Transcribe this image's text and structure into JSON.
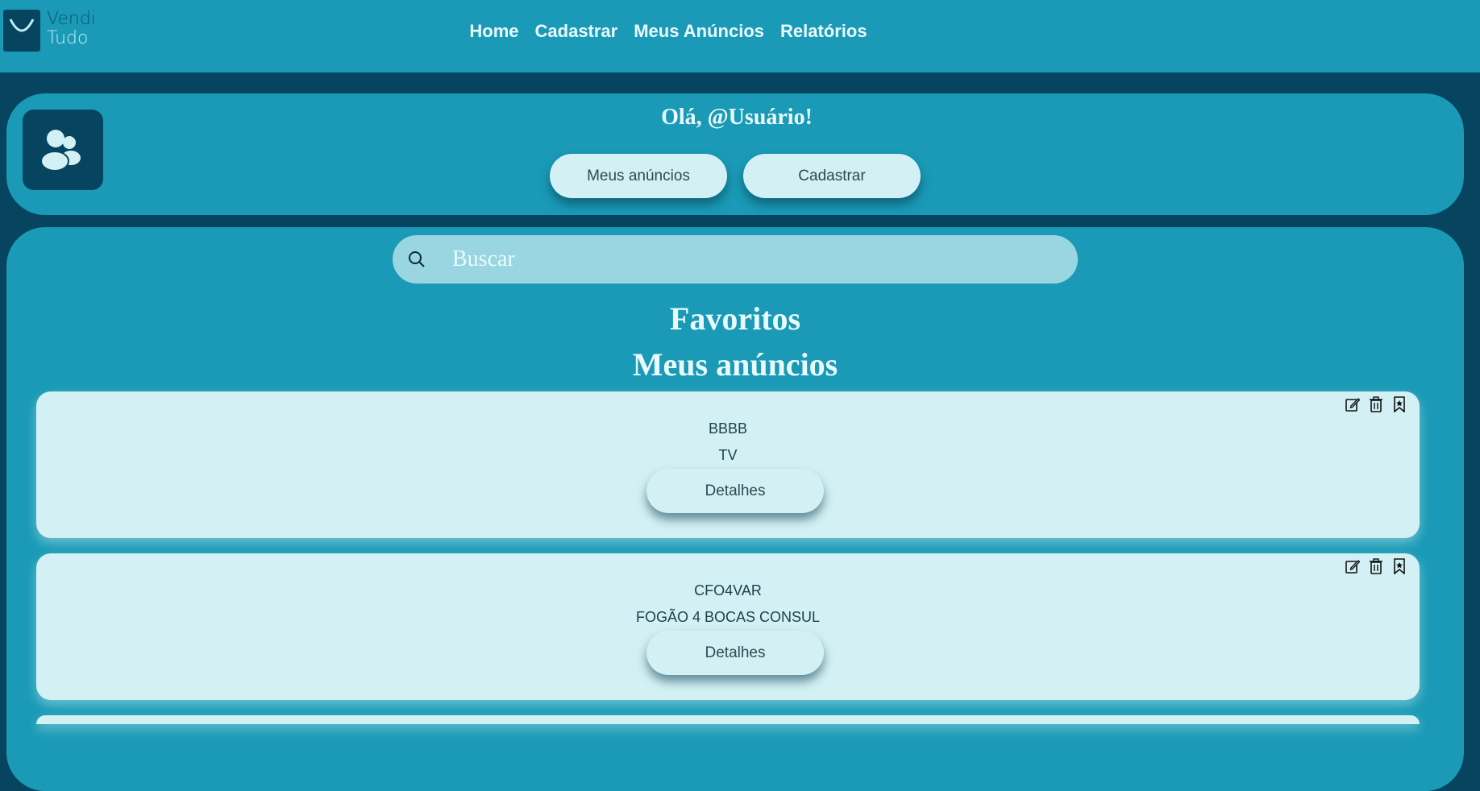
{
  "brand": {
    "line1": "Vendi",
    "line2": "Tudo"
  },
  "nav": [
    "Home",
    "Cadastrar",
    "Meus Anúncios",
    "Relatórios"
  ],
  "profile": {
    "greeting": "Olá, @Usuário!",
    "my_ads_label": "Meus anúncios",
    "register_label": "Cadastrar"
  },
  "search": {
    "placeholder": "Buscar"
  },
  "sections": {
    "favorites": "Favoritos",
    "my_ads": "Meus anúncios"
  },
  "ads": [
    {
      "code": "BBBB",
      "name": "TV",
      "details_label": "Detalhes"
    },
    {
      "code": "CFO4VAR",
      "name": "FOGÃO 4 BOCAS CONSUL",
      "details_label": "Detalhes"
    }
  ],
  "icons": [
    "edit-icon",
    "trash-icon",
    "bookmark-icon",
    "search-icon",
    "users-icon",
    "shopping-bag-icon"
  ],
  "colors": {
    "dark": "#06445f",
    "primary": "#1a9ab6",
    "light": "#d3f1f4"
  }
}
